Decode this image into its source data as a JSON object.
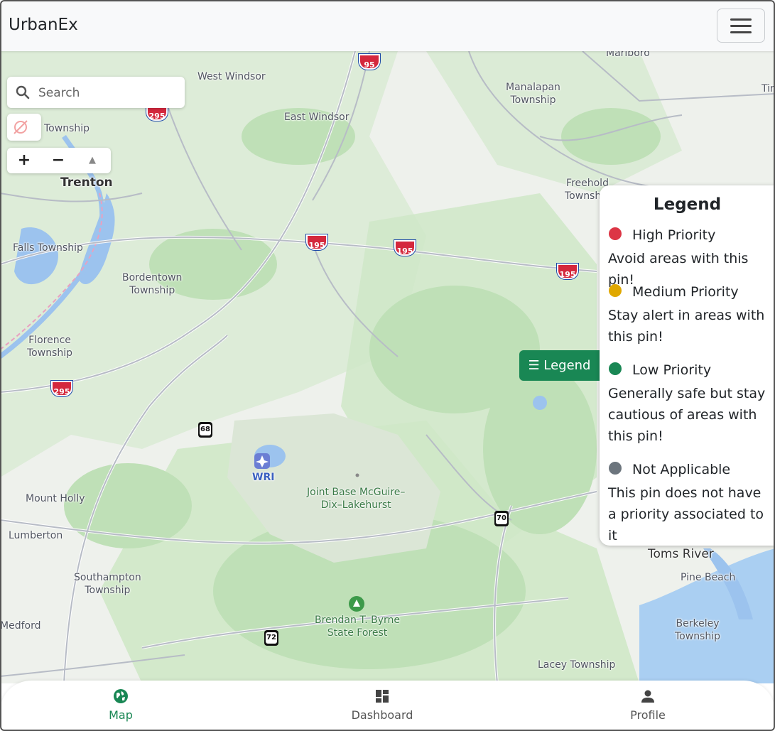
{
  "app": {
    "title": "UrbanEx",
    "menu_icon": "hamburger-icon"
  },
  "map": {
    "search": {
      "placeholder": "Search",
      "icon": "search-icon"
    },
    "geolocate_icon": "location-off-icon",
    "zoom_in": "+",
    "zoom_out": "−",
    "compass": "▲",
    "places": [
      "West Windsor",
      "East Windsor",
      "Manalapan\nTownship",
      "Marlboro",
      "Tin",
      "Township",
      "Trenton",
      "Freehold\nTownship",
      "Falls Township",
      "Bordentown\nTownship",
      "Florence\nTownship",
      "Mount Holly",
      "Lumberton",
      "Southampton\nTownship",
      "Medford",
      "Joint Base McGuire–\nDix–Lakehurst",
      "WRI",
      "Brendan T. Byrne\nState Forest",
      "Toms River",
      "Pine Beach",
      "Berkeley\nTownship",
      "Lacey Township"
    ],
    "shields": {
      "i295": "295",
      "i95": "95",
      "i195": "195",
      "r68": "68",
      "r70": "70",
      "r72": "72"
    }
  },
  "legend": {
    "button_label": "☰ Legend",
    "title": "Legend",
    "items": [
      {
        "label": "High Priority",
        "desc": "Avoid areas with this pin!",
        "color": "#dc3545"
      },
      {
        "label": "Medium Priority",
        "desc": "Stay alert in areas with this pin!",
        "color": "#e0a800"
      },
      {
        "label": "Low Priority",
        "desc": "Generally safe but stay cautious of areas with this pin!",
        "color": "#198754"
      },
      {
        "label": "Not Applicable",
        "desc": "This pin does not have a priority associated to it",
        "color": "#6c757d"
      }
    ]
  },
  "bottom_nav": {
    "items": [
      {
        "label": "Map",
        "icon": "globe-icon",
        "active": true
      },
      {
        "label": "Dashboard",
        "icon": "dashboard-icon",
        "active": false
      },
      {
        "label": "Profile",
        "icon": "person-icon",
        "active": false
      }
    ]
  },
  "colors": {
    "accent": "#198754",
    "water": "#9cc3ee",
    "park": "#c8e6c2"
  }
}
